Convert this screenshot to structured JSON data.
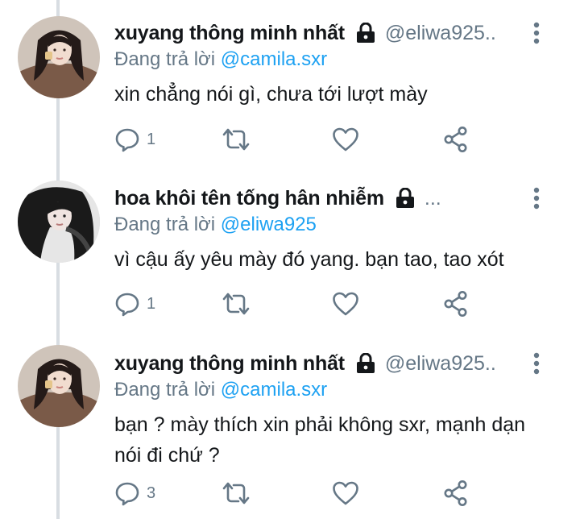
{
  "replying_label": "Đang trả lời",
  "colors": {
    "name": "#14171a",
    "secondary": "#657786",
    "link": "#1da1f2",
    "thread_line": "#d8dde2"
  },
  "tweets": [
    {
      "display_name": "xuyang thông minh nhất",
      "handle": "@eliwa925..",
      "protected": true,
      "replying_to": "@camila.sxr",
      "text": "xin chẳng nói gì, chưa tới lượt mày",
      "reply_count": "1",
      "icons": [
        "reply-icon",
        "retweet-icon",
        "like-icon",
        "share-icon"
      ]
    },
    {
      "display_name": "hoa khôi tên tống hân nhiễm",
      "handle": "...",
      "protected": true,
      "replying_to": "@eliwa925",
      "text": "vì cậu ấy yêu mày đó yang. bạn tao, tao xót",
      "reply_count": "1",
      "icons": [
        "reply-icon",
        "retweet-icon",
        "like-icon",
        "share-icon"
      ]
    },
    {
      "display_name": "xuyang thông minh nhất",
      "handle": "@eliwa925..",
      "protected": true,
      "replying_to": "@camila.sxr",
      "text": "bạn ? mày thích xin phải không sxr, mạnh dạn nói đi chứ ?",
      "reply_count": "3",
      "icons": [
        "reply-icon",
        "retweet-icon",
        "like-icon",
        "share-icon"
      ]
    }
  ]
}
